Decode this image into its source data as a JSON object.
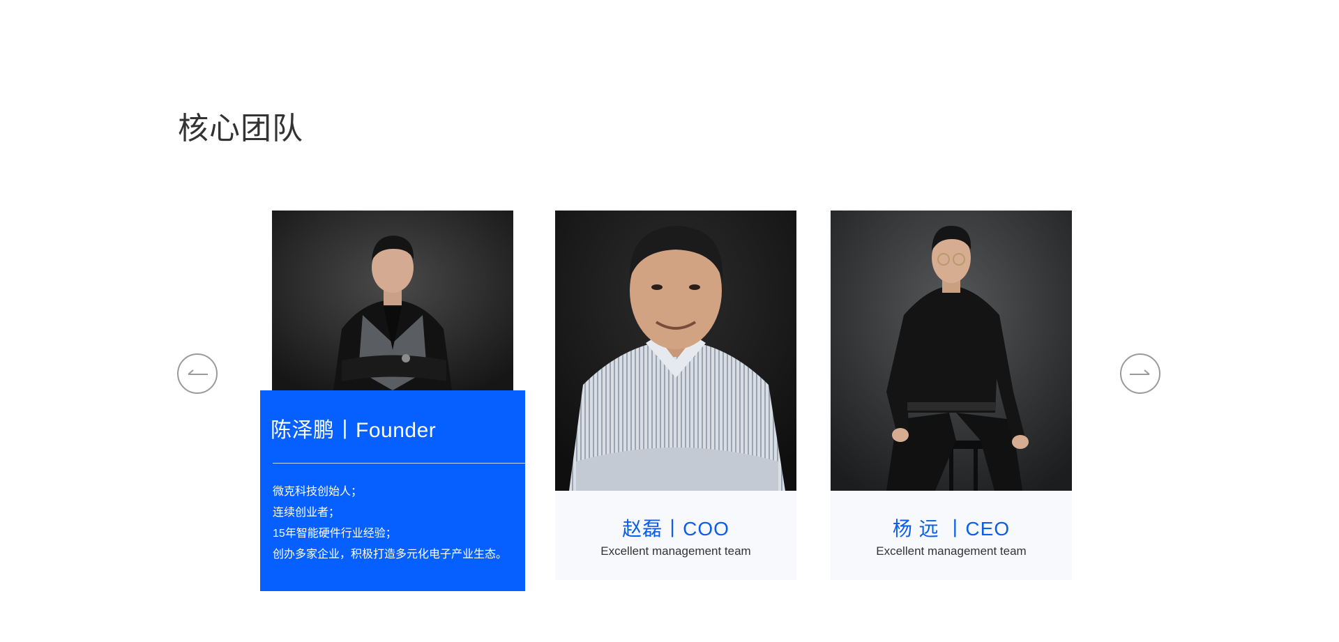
{
  "section": {
    "title": "核心团队"
  },
  "carousel": {
    "prev_icon": "arrow-left-icon",
    "next_icon": "arrow-right-icon"
  },
  "team": [
    {
      "name_role": "陈泽鹏丨Founder",
      "bio": [
        "微克科技创始人；",
        "连续创业者；",
        "15年智能硬件行业经验；",
        "创办多家企业，积极打造多元化电子产业生态。"
      ],
      "active": true
    },
    {
      "name_role": "赵磊丨COO",
      "subtitle": "Excellent management team"
    },
    {
      "name_role": "杨 远 丨CEO",
      "subtitle": "Excellent management team"
    }
  ],
  "colors": {
    "accent": "#0560ff",
    "caption_bg": "#f7f9fc",
    "name_blue": "#0a5ee8"
  }
}
